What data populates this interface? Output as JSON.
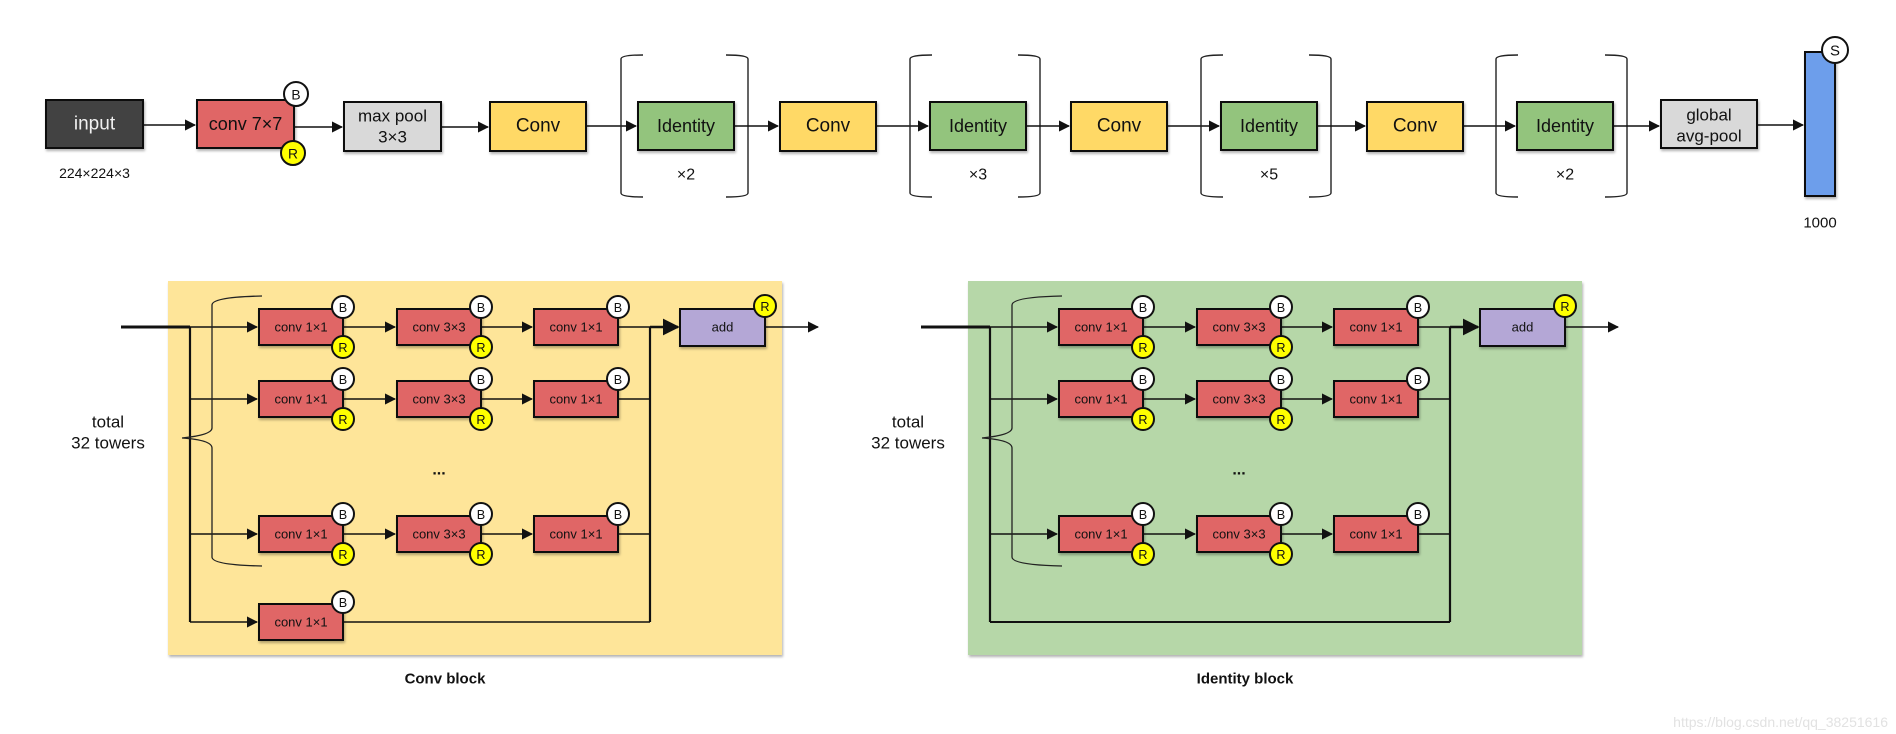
{
  "colors": {
    "input": "#434343",
    "conv": "#e06666",
    "pool": "#d9d9d9",
    "conv_block": "#ffd966",
    "identity_block": "#93c47d",
    "fc": "#6d9eeb",
    "add": "#b4a7d6",
    "conv_panel_bg": "#fee599",
    "identity_panel_bg": "#b6d7a8",
    "badge_B": "#ffffff",
    "badge_R": "#ffff00",
    "stroke": "#111111"
  },
  "top_row": {
    "input": {
      "label": "input",
      "caption": "224×224×3"
    },
    "conv7": {
      "label": "conv 7×7",
      "badges": [
        "B",
        "R"
      ]
    },
    "maxpool": {
      "label_line1": "max pool",
      "label_line2": "3×3"
    },
    "stages": [
      {
        "conv_label": "Conv",
        "identity_label": "Identity",
        "repeat": "×2"
      },
      {
        "conv_label": "Conv",
        "identity_label": "Identity",
        "repeat": "×3"
      },
      {
        "conv_label": "Conv",
        "identity_label": "Identity",
        "repeat": "×5"
      },
      {
        "conv_label": "Conv",
        "identity_label": "Identity",
        "repeat": "×2"
      }
    ],
    "gap": {
      "label_line1": "global",
      "label_line2": "avg-pool"
    },
    "fc": {
      "badge": "S",
      "caption": "1000"
    }
  },
  "blocks": [
    {
      "id": "conv",
      "title": "Conv block",
      "towers_label_line1": "total",
      "towers_label_line2": "32 towers",
      "tower_layers": [
        "conv 1×1",
        "conv 3×3",
        "conv 1×1"
      ],
      "ellipsis": "...",
      "shortcut_label": "conv 1×1",
      "add_label": "add",
      "badge_B": "B",
      "badge_R": "R"
    },
    {
      "id": "identity",
      "title": "Identity block",
      "towers_label_line1": "total",
      "towers_label_line2": "32 towers",
      "tower_layers": [
        "conv 1×1",
        "conv 3×3",
        "conv 1×1"
      ],
      "ellipsis": "...",
      "shortcut_label": "",
      "add_label": "add",
      "badge_B": "B",
      "badge_R": "R"
    }
  ],
  "watermark": "https://blog.csdn.net/qq_38251616"
}
